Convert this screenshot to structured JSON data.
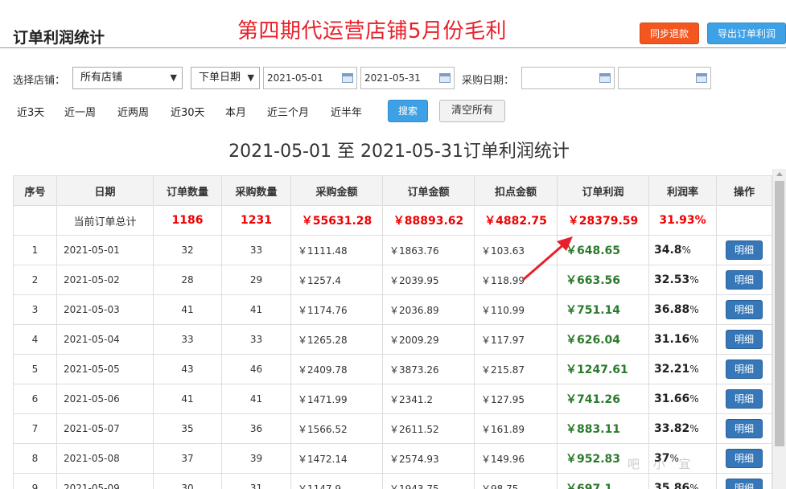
{
  "header": {
    "title": "订单利润统计",
    "overlay_title": "第四期代运营店铺5月份毛利",
    "sync_refund_label": "同步退款",
    "export_label": "导出订单利润"
  },
  "filters": {
    "store_label": "选择店铺：",
    "store_value": "所有店铺",
    "date_type_value": "下单日期",
    "start_date": "2021-05-01",
    "end_date": "2021-05-31",
    "purchase_date_label": "采购日期：",
    "purchase_start": "",
    "purchase_end": ""
  },
  "quick_ranges": [
    "近3天",
    "近一周",
    "近两周",
    "近30天",
    "本月",
    "近三个月",
    "近半年"
  ],
  "search_label": "搜索",
  "clear_label": "清空所有",
  "report_title": "2021-05-01 至 2021-05-31订单利润统计",
  "table": {
    "columns": [
      "序号",
      "日期",
      "订单数量",
      "采购数量",
      "采购金额",
      "订单金额",
      "扣点金额",
      "订单利润",
      "利润率",
      "操作"
    ],
    "total": {
      "label": "当前订单总计",
      "orders": "1186",
      "purchases": "1231",
      "purchase_amount": "￥55631.28",
      "order_amount": "￥88893.62",
      "deduction": "￥4882.75",
      "profit": "￥28379.59",
      "rate": "31.93%"
    },
    "detail_label": "明细",
    "rows": [
      {
        "no": "1",
        "date": "2021-05-01",
        "orders": "32",
        "purchases": "33",
        "purchase_amount": "￥1111.48",
        "order_amount": "￥1863.76",
        "deduction": "￥103.63",
        "profit": "￥648.65",
        "rate": "34.8",
        "pct": "%"
      },
      {
        "no": "2",
        "date": "2021-05-02",
        "orders": "28",
        "purchases": "29",
        "purchase_amount": "￥1257.4",
        "order_amount": "￥2039.95",
        "deduction": "￥118.99",
        "profit": "￥663.56",
        "rate": "32.53",
        "pct": "%"
      },
      {
        "no": "3",
        "date": "2021-05-03",
        "orders": "41",
        "purchases": "41",
        "purchase_amount": "￥1174.76",
        "order_amount": "￥2036.89",
        "deduction": "￥110.99",
        "profit": "￥751.14",
        "rate": "36.88",
        "pct": "%"
      },
      {
        "no": "4",
        "date": "2021-05-04",
        "orders": "33",
        "purchases": "33",
        "purchase_amount": "￥1265.28",
        "order_amount": "￥2009.29",
        "deduction": "￥117.97",
        "profit": "￥626.04",
        "rate": "31.16",
        "pct": "%"
      },
      {
        "no": "5",
        "date": "2021-05-05",
        "orders": "43",
        "purchases": "46",
        "purchase_amount": "￥2409.78",
        "order_amount": "￥3873.26",
        "deduction": "￥215.87",
        "profit": "￥1247.61",
        "rate": "32.21",
        "pct": "%"
      },
      {
        "no": "6",
        "date": "2021-05-06",
        "orders": "41",
        "purchases": "41",
        "purchase_amount": "￥1471.99",
        "order_amount": "￥2341.2",
        "deduction": "￥127.95",
        "profit": "￥741.26",
        "rate": "31.66",
        "pct": "%"
      },
      {
        "no": "7",
        "date": "2021-05-07",
        "orders": "35",
        "purchases": "36",
        "purchase_amount": "￥1566.52",
        "order_amount": "￥2611.52",
        "deduction": "￥161.89",
        "profit": "￥883.11",
        "rate": "33.82",
        "pct": "%"
      },
      {
        "no": "8",
        "date": "2021-05-08",
        "orders": "37",
        "purchases": "39",
        "purchase_amount": "￥1472.14",
        "order_amount": "￥2574.93",
        "deduction": "￥149.96",
        "profit": "￥952.83",
        "rate": "37",
        "pct": "%"
      },
      {
        "no": "9",
        "date": "2021-05-09",
        "orders": "30",
        "purchases": "31",
        "purchase_amount": "￥1147.9",
        "order_amount": "￥1943.75",
        "deduction": "￥98.75",
        "profit": "￥697.1",
        "rate": "35.86",
        "pct": "%"
      }
    ]
  },
  "colors": {
    "accent_blue": "#3ea1e6",
    "accent_orange": "#f4561f",
    "total_red": "#e00000",
    "profit_green": "#2b7a2b",
    "annotation_red": "#e8202a"
  }
}
